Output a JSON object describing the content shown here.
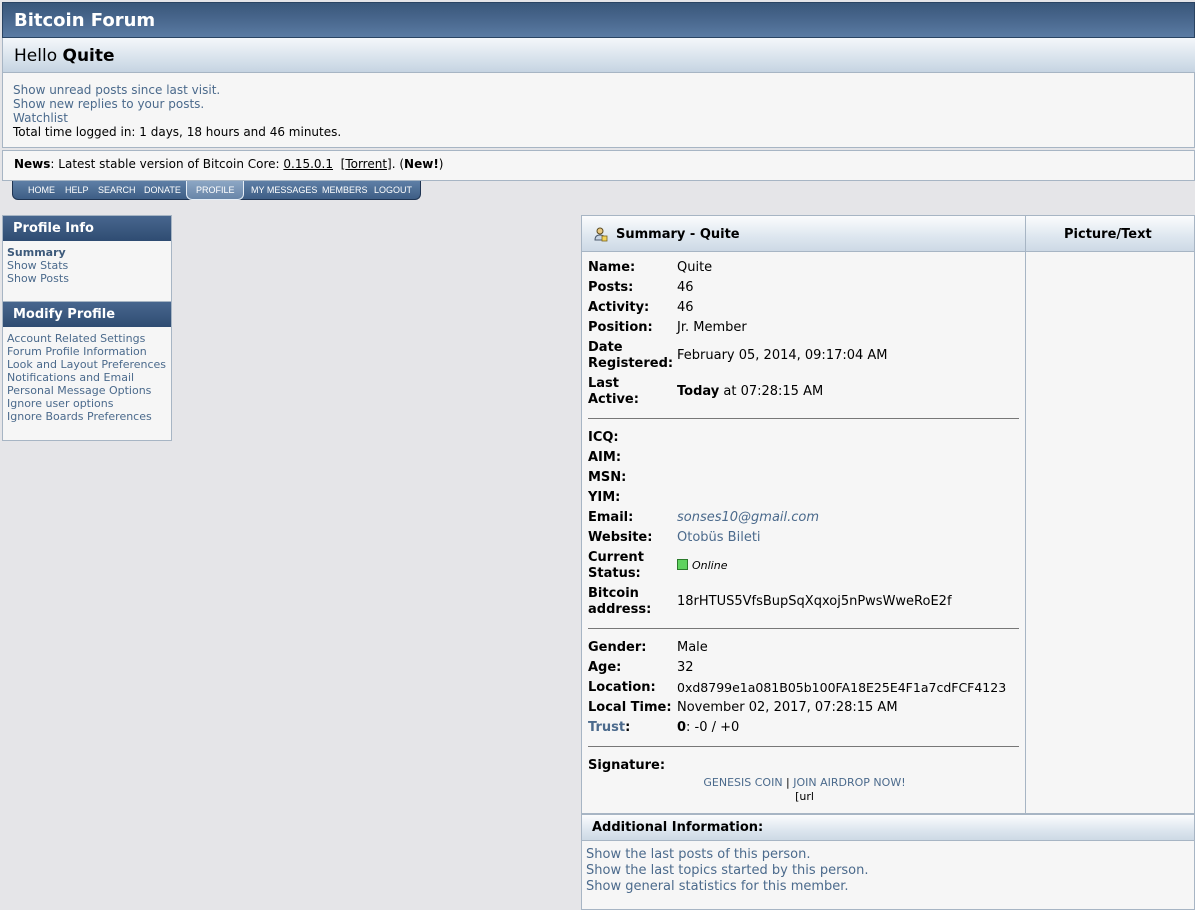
{
  "header": {
    "title": "Bitcoin Forum",
    "hello": "Hello",
    "username": "Quite"
  },
  "userbox": {
    "unread": "Show unread posts since last visit.",
    "replies": "Show new replies to your posts.",
    "watchlist": "Watchlist",
    "time_logged": "Total time logged in: 1 days, 18 hours and 46 minutes."
  },
  "news": {
    "label": "News",
    "text": ": Latest stable version of Bitcoin Core: ",
    "version": "0.15.0.1",
    "torrent": "Torrent",
    "new": "New!"
  },
  "menu": [
    "HOME",
    "HELP",
    "SEARCH",
    "DONATE",
    "PROFILE",
    "MY MESSAGES",
    "MEMBERS",
    "LOGOUT"
  ],
  "sidebar": {
    "profile_info_title": "Profile Info",
    "profile_info": [
      "Summary",
      "Show Stats",
      "Show Posts"
    ],
    "modify_title": "Modify Profile",
    "modify": [
      "Account Related Settings",
      "Forum Profile Information",
      "Look and Layout Preferences",
      "Notifications and Email",
      "Personal Message Options",
      "Ignore user options",
      "Ignore Boards Preferences"
    ]
  },
  "summary": {
    "title": "Summary - Quite",
    "picture_title": "Picture/Text",
    "name_label": "Name:",
    "name": "Quite",
    "posts_label": "Posts:",
    "posts": "46",
    "activity_label": "Activity:",
    "activity": "46",
    "position_label": "Position:",
    "position": "Jr. Member",
    "date_label_1": "Date",
    "date_label_2": "Registered:",
    "date": "February 05, 2014, 09:17:04 AM",
    "last_label_1": "Last",
    "last_label_2": "Active:",
    "last_today": "Today",
    "last_rest": " at 07:28:15 AM",
    "icq_label": "ICQ:",
    "aim_label": "AIM:",
    "msn_label": "MSN:",
    "yim_label": "YIM:",
    "email_label": "Email:",
    "email": "sonses10@gmail.com",
    "website_label": "Website:",
    "website": "Otobüs Bileti",
    "status_label_1": "Current",
    "status_label_2": "Status:",
    "status": "Online",
    "btc_label_1": "Bitcoin",
    "btc_label_2": "address:",
    "btc": "18rHTUS5VfsBupSqXqxoj5nPwsWweRoE2f",
    "gender_label": "Gender:",
    "gender": "Male",
    "age_label": "Age:",
    "age": "32",
    "location_label": "Location:",
    "location": "0xd8799e1a081B05b100FA18E25E4F1a7cdFCF4123",
    "localtime_label": "Local Time:",
    "localtime": "November 02, 2017, 07:28:15 AM",
    "trust_label": "Trust",
    "trust_colon": ":",
    "trust_score": "0",
    "trust_rest": ": -0 / +0",
    "signature_label": "Signature:",
    "sig_link1": "GENESIS COIN",
    "sig_sep": " | ",
    "sig_link2": "JOIN AIRDROP NOW!",
    "sig_url": "[url"
  },
  "additional": {
    "title": "Additional Information:",
    "links": [
      "Show the last posts of this person.",
      "Show the last topics started by this person.",
      "Show general statistics for this member."
    ]
  }
}
